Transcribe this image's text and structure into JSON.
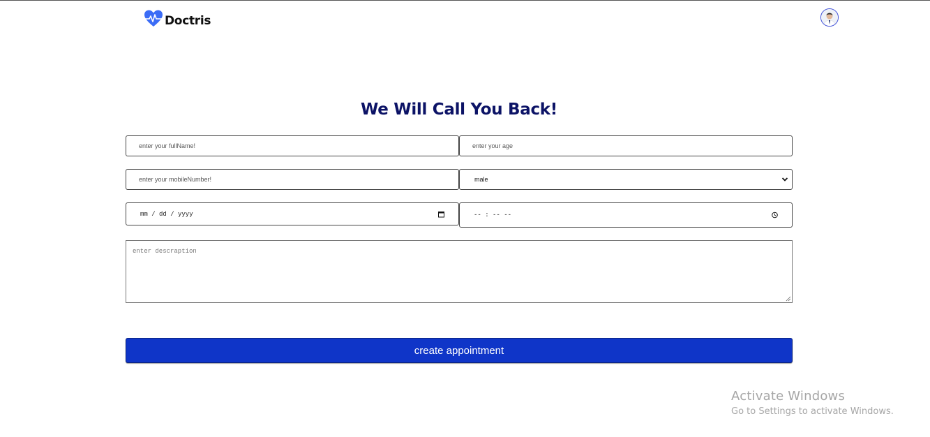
{
  "brand": {
    "name": "Doctris",
    "accent": "#3b6cf6"
  },
  "header": {
    "avatar_icon": "user-avatar"
  },
  "form": {
    "title": "We Will Call You Back!",
    "fullname_placeholder": "enter  your fullName!",
    "age_placeholder": "enter your  age",
    "mobile_placeholder": "enter  your mobileNumber!",
    "gender_selected": "male",
    "date_placeholder": "mm / dd / yyyy",
    "time_placeholder": "-- : --  --",
    "description_placeholder": "enter descraption",
    "submit_label": "create appointment",
    "submit_color": "#0f35c8",
    "title_color": "#0c1366"
  },
  "watermark": {
    "title": "Activate Windows",
    "subtitle": "Go to Settings to activate Windows."
  }
}
